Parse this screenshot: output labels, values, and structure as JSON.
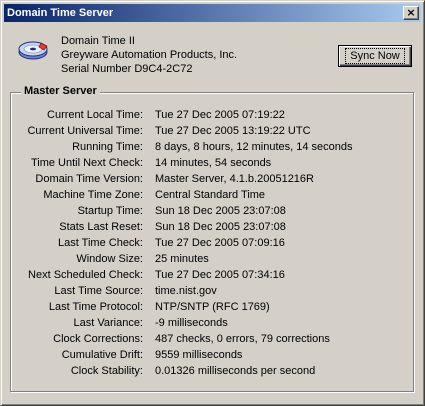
{
  "window": {
    "title": "Domain Time Server",
    "close_glyph": "×"
  },
  "app_icon": "disk-icon",
  "product": {
    "name": "Domain Time II",
    "company": "Greyware Automation Products, Inc.",
    "serial": "Serial Number D9C4-2C72"
  },
  "sync_button": {
    "label": "Sync Now"
  },
  "master_server": {
    "title": "Master Server",
    "rows": [
      {
        "label": "Current Local Time:",
        "value": "Tue 27 Dec 2005 07:19:22"
      },
      {
        "label": "Current Universal Time:",
        "value": "Tue 27 Dec 2005 13:19:22 UTC"
      },
      {
        "label": "Running Time:",
        "value": "8 days, 8 hours, 12 minutes, 14 seconds"
      },
      {
        "label": "Time Until Next Check:",
        "value": "14 minutes, 54 seconds"
      },
      {
        "label": "Domain Time Version:",
        "value": "Master Server, 4.1.b.20051216R"
      },
      {
        "label": "Machine Time Zone:",
        "value": "Central Standard Time"
      },
      {
        "label": "Startup Time:",
        "value": "Sun 18 Dec 2005 23:07:08"
      },
      {
        "label": "Stats Last Reset:",
        "value": "Sun 18 Dec 2005 23:07:08"
      },
      {
        "label": "Last Time Check:",
        "value": "Tue 27 Dec 2005 07:09:16"
      },
      {
        "label": "Window Size:",
        "value": "25 minutes"
      },
      {
        "label": "Next Scheduled Check:",
        "value": "Tue 27 Dec 2005 07:34:16"
      },
      {
        "label": "Last Time Source:",
        "value": "time.nist.gov"
      },
      {
        "label": "Last Time Protocol:",
        "value": "NTP/SNTP (RFC 1769)"
      },
      {
        "label": "Last Variance:",
        "value": "-9 milliseconds"
      },
      {
        "label": "Clock Corrections:",
        "value": "487 checks, 0 errors, 79 corrections"
      },
      {
        "label": "Cumulative Drift:",
        "value": "9559 milliseconds"
      },
      {
        "label": "Clock Stability:",
        "value": "0.01326 milliseconds per second"
      }
    ]
  },
  "colors": {
    "title_bar_start": "#0a246a",
    "title_bar_end": "#a6caf0",
    "window_face": "#d4d0c8"
  }
}
